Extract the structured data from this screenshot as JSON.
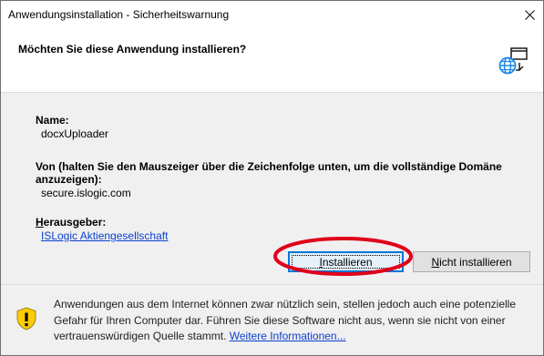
{
  "window": {
    "title": "Anwendungsinstallation - Sicherheitswarnung",
    "close_glyph": "✕"
  },
  "header": {
    "question": "Möchten Sie diese Anwendung installieren?",
    "icon": "install-globe-icon"
  },
  "details": {
    "name_label": "Name:",
    "name_value": "docxUploader",
    "from_label_line1": "Von (halten Sie den Mauszeiger über die Zeichenfolge unten, um die vollständige Domäne",
    "from_label_line2": "anzuzeigen):",
    "from_value": "secure.islogic.com",
    "publisher_label": "Herausgeber:",
    "publisher_value": "ISLogic Aktiengesellschaft"
  },
  "buttons": {
    "install": "Installieren",
    "dont_install": "Nicht installieren"
  },
  "annotation": {
    "color": "#e0001b"
  },
  "footer": {
    "warning_line1": "Anwendungen aus dem Internet können zwar nützlich sein, stellen jedoch auch eine potenzielle",
    "warning_line2": "Gefahr für Ihren Computer dar. Führen Sie diese Software nicht aus, wenn sie nicht von einer",
    "warning_line3_prefix": "vertrauenswürdigen Quelle stammt.",
    "more_info_link": "Weitere Informationen...",
    "icon": "warning-shield-icon"
  }
}
